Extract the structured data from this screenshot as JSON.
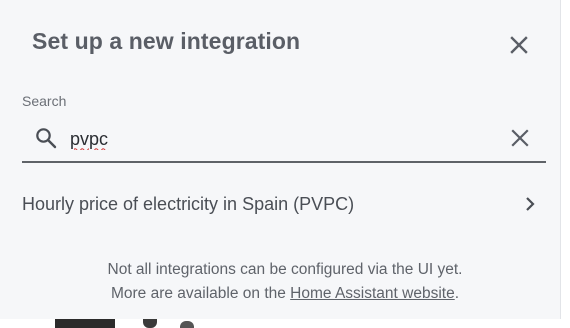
{
  "dialog": {
    "title": "Set up a new integration",
    "close_icon": "close-icon"
  },
  "search": {
    "label": "Search",
    "value": "pvpc",
    "search_icon": "search-icon",
    "clear_icon": "close-icon"
  },
  "results": [
    {
      "label": "Hourly price of electricity in Spain (PVPC)",
      "icon": "chevron-right-icon"
    }
  ],
  "footer": {
    "line1": "Not all integrations can be configured via the UI yet.",
    "line2_prefix": "More are available on the ",
    "link_text": "Home Assistant website",
    "line2_suffix": "."
  },
  "colors": {
    "dialog_bg": "#f6f7f9",
    "title": "#5a5e66",
    "text": "#4a4e55",
    "spellcheck": "#d23a3a"
  }
}
